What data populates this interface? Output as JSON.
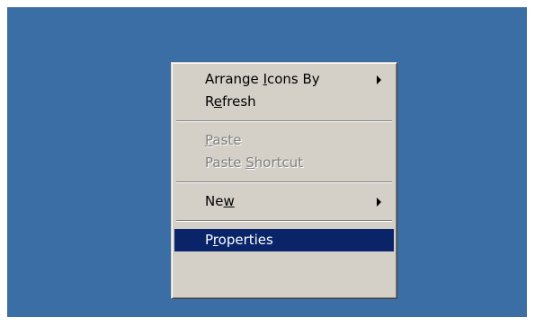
{
  "context_menu": {
    "items": [
      {
        "label": "Arrange Icons By",
        "accelerator": "I",
        "has_submenu": true,
        "disabled": false
      },
      {
        "label": "Refresh",
        "accelerator": "e",
        "has_submenu": false,
        "disabled": false
      },
      {
        "label": "Paste",
        "accelerator": "P",
        "has_submenu": false,
        "disabled": true
      },
      {
        "label": "Paste Shortcut",
        "accelerator": "S",
        "has_submenu": false,
        "disabled": true
      },
      {
        "label": "New",
        "accelerator": "w",
        "has_submenu": true,
        "disabled": false
      },
      {
        "label": "Properties",
        "accelerator": "r",
        "has_submenu": false,
        "disabled": false,
        "selected": true
      }
    ]
  },
  "colors": {
    "desktop_background": "#3a6ea5",
    "menu_background": "#d4d0c8",
    "highlight": "#0a246a",
    "disabled_text": "#808080"
  },
  "icons": {
    "submenu_arrow": "triangle-right-icon"
  }
}
